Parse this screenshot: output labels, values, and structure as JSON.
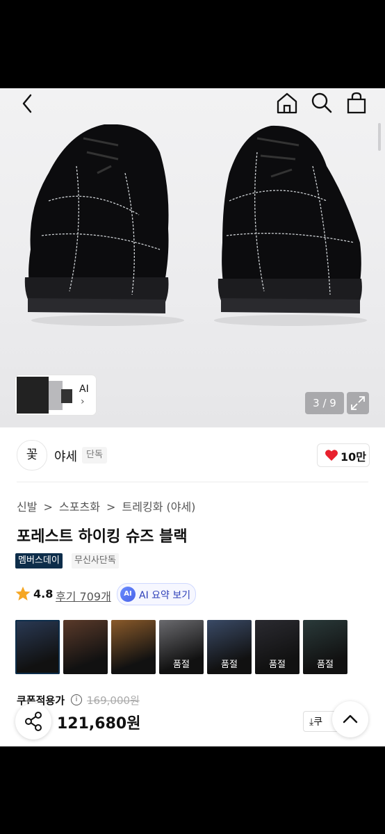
{
  "hero": {
    "pager_text": "3 / 9",
    "ai_thumb_label": "AI",
    "ai_thumb_chevron": "›",
    "icons": [
      "back-icon",
      "home-icon",
      "search-icon",
      "shopping-bag-icon",
      "expand-icon"
    ]
  },
  "brand": {
    "logo_glyph": "꽃",
    "name": "야세",
    "badge": "단독",
    "like_count": "10만"
  },
  "breadcrumb": {
    "items": [
      "신발",
      "스포츠화",
      "트레킹화 (야세)"
    ],
    "separator": ">"
  },
  "product": {
    "title": "포레스트 하이킹 슈즈 블랙",
    "tags": [
      "멤버스데이",
      "무신사단독"
    ],
    "rating": "4.8",
    "reviews_text": "후기 709개",
    "ai_summary_badge": "AI",
    "ai_summary_text": "AI 요약 보기"
  },
  "swatches": {
    "items": [
      {
        "soldout": ""
      },
      {
        "soldout": ""
      },
      {
        "soldout": ""
      },
      {
        "soldout": "품절"
      },
      {
        "soldout": "품절"
      },
      {
        "soldout": "품절"
      },
      {
        "soldout": "품절"
      }
    ],
    "colors": [
      "#2a3a55",
      "#5a3a2a",
      "#8a5a2a",
      "#6a6a6e",
      "#3a4a66",
      "#2a2a30",
      "#2a3a3a"
    ]
  },
  "price": {
    "coupon_label": "쿠폰적용가",
    "info_glyph": "i",
    "original": "169,000원",
    "final": "121,680원",
    "coupon_button": "⤓쿠"
  },
  "colors": {
    "like_heart": "#e8202d",
    "member_tag_bg": "#0d2d4a",
    "star": "#f5a623"
  }
}
